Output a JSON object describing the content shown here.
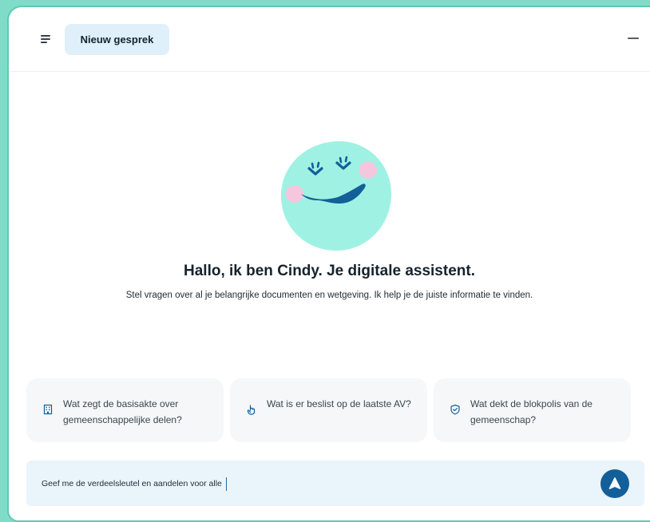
{
  "header": {
    "new_chat_label": "Nieuw gesprek"
  },
  "welcome": {
    "title": "Hallo, ik ben Cindy. Je digitale assistent.",
    "subtitle": "Stel vragen over al je belangrijke documenten en wetgeving. Ik help je de juiste informatie te vinden."
  },
  "suggestions": [
    {
      "icon": "building-icon",
      "text": "Wat zegt de basisakte over gemeenschappelijke delen?"
    },
    {
      "icon": "hand-pointer-icon",
      "text": "Wat is er beslist op de laatste AV?"
    },
    {
      "icon": "shield-icon",
      "text": "Wat dekt de blokpolis van de gemeenschap?"
    }
  ],
  "composer": {
    "value": "Geef me de verdeelsleutel en aandelen voor alle"
  },
  "colors": {
    "background": "#7fdcc8",
    "accent": "#135f99",
    "new_chat_bg": "#dff0fb",
    "composer_bg": "#eaf4fb",
    "avatar_face": "#9ff2e3",
    "avatar_cheek": "#f6c6de"
  }
}
